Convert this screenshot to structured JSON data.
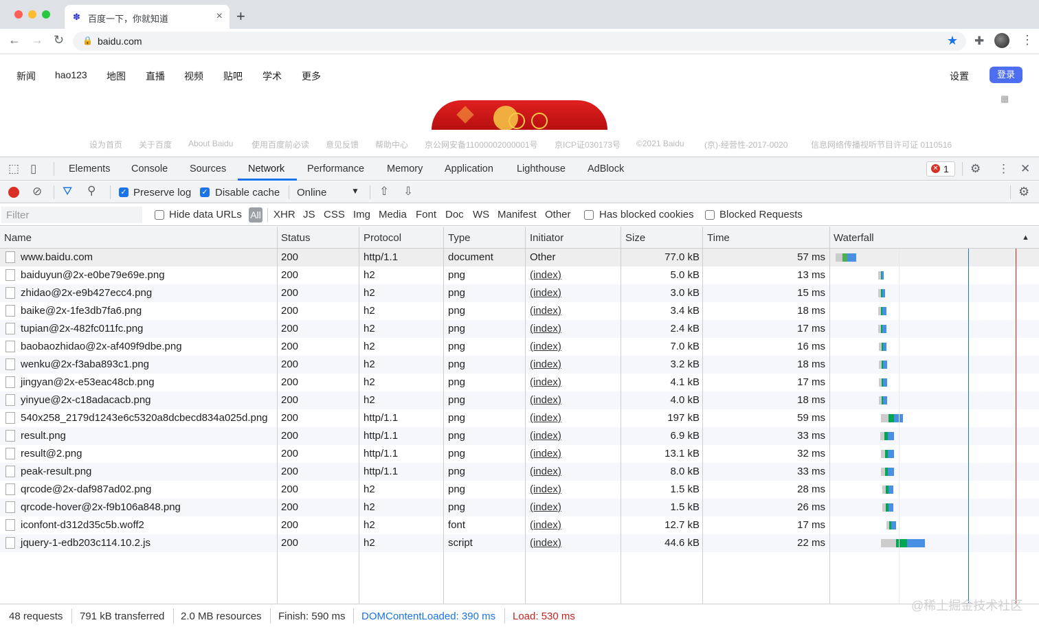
{
  "browser": {
    "tab_title": "百度一下，你就知道",
    "tab_close": "×",
    "new_tab": "+",
    "url": "baidu.com"
  },
  "page": {
    "nav_left": [
      "新闻",
      "hao123",
      "地图",
      "直播",
      "视频",
      "贴吧",
      "学术",
      "更多"
    ],
    "settings": "设置",
    "login": "登录",
    "footer_links": [
      "设为首页",
      "关于百度",
      "About Baidu",
      "使用百度前必读",
      "意见反馈",
      "帮助中心",
      "京公网安备11000002000001号",
      "京ICP证030173号",
      "©2021 Baidu",
      "(京)-经营性-2017-0020",
      "信息网络传播视听节目许可证 0110516"
    ]
  },
  "devtools": {
    "tabs": [
      "Elements",
      "Console",
      "Sources",
      "Network",
      "Performance",
      "Memory",
      "Application",
      "Lighthouse",
      "AdBlock"
    ],
    "active_tab": "Network",
    "error_count": "1",
    "controls": {
      "preserve_log": "Preserve log",
      "disable_cache": "Disable cache",
      "throttle": "Online"
    },
    "filter": {
      "placeholder": "Filter",
      "hide_data_urls": "Hide data URLs",
      "all": "All",
      "types": [
        "XHR",
        "JS",
        "CSS",
        "Img",
        "Media",
        "Font",
        "Doc",
        "WS",
        "Manifest",
        "Other"
      ],
      "has_blocked_cookies": "Has blocked cookies",
      "blocked_requests": "Blocked Requests"
    },
    "columns": [
      "Name",
      "Status",
      "Protocol",
      "Type",
      "Initiator",
      "Size",
      "Time",
      "Waterfall"
    ],
    "rows": [
      {
        "name": "www.baidu.com",
        "status": "200",
        "protocol": "http/1.1",
        "type": "document",
        "initiator": "Other",
        "size": "77.0 kB",
        "time": "57 ms"
      },
      {
        "name": "baiduyun@2x-e0be79e69e.png",
        "status": "200",
        "protocol": "h2",
        "type": "png",
        "initiator": "(index)",
        "size": "5.0 kB",
        "time": "13 ms"
      },
      {
        "name": "zhidao@2x-e9b427ecc4.png",
        "status": "200",
        "protocol": "h2",
        "type": "png",
        "initiator": "(index)",
        "size": "3.0 kB",
        "time": "15 ms"
      },
      {
        "name": "baike@2x-1fe3db7fa6.png",
        "status": "200",
        "protocol": "h2",
        "type": "png",
        "initiator": "(index)",
        "size": "3.4 kB",
        "time": "18 ms"
      },
      {
        "name": "tupian@2x-482fc011fc.png",
        "status": "200",
        "protocol": "h2",
        "type": "png",
        "initiator": "(index)",
        "size": "2.4 kB",
        "time": "17 ms"
      },
      {
        "name": "baobaozhidao@2x-af409f9dbe.png",
        "status": "200",
        "protocol": "h2",
        "type": "png",
        "initiator": "(index)",
        "size": "7.0 kB",
        "time": "16 ms"
      },
      {
        "name": "wenku@2x-f3aba893c1.png",
        "status": "200",
        "protocol": "h2",
        "type": "png",
        "initiator": "(index)",
        "size": "3.2 kB",
        "time": "18 ms"
      },
      {
        "name": "jingyan@2x-e53eac48cb.png",
        "status": "200",
        "protocol": "h2",
        "type": "png",
        "initiator": "(index)",
        "size": "4.1 kB",
        "time": "17 ms"
      },
      {
        "name": "yinyue@2x-c18adacacb.png",
        "status": "200",
        "protocol": "h2",
        "type": "png",
        "initiator": "(index)",
        "size": "4.0 kB",
        "time": "18 ms"
      },
      {
        "name": "540x258_2179d1243e6c5320a8dcbecd834a025d.png",
        "status": "200",
        "protocol": "http/1.1",
        "type": "png",
        "initiator": "(index)",
        "size": "197 kB",
        "time": "59 ms"
      },
      {
        "name": "result.png",
        "status": "200",
        "protocol": "http/1.1",
        "type": "png",
        "initiator": "(index)",
        "size": "6.9 kB",
        "time": "33 ms"
      },
      {
        "name": "result@2.png",
        "status": "200",
        "protocol": "http/1.1",
        "type": "png",
        "initiator": "(index)",
        "size": "13.1 kB",
        "time": "32 ms"
      },
      {
        "name": "peak-result.png",
        "status": "200",
        "protocol": "http/1.1",
        "type": "png",
        "initiator": "(index)",
        "size": "8.0 kB",
        "time": "33 ms"
      },
      {
        "name": "qrcode@2x-daf987ad02.png",
        "status": "200",
        "protocol": "h2",
        "type": "png",
        "initiator": "(index)",
        "size": "1.5 kB",
        "time": "28 ms"
      },
      {
        "name": "qrcode-hover@2x-f9b106a848.png",
        "status": "200",
        "protocol": "h2",
        "type": "png",
        "initiator": "(index)",
        "size": "1.5 kB",
        "time": "26 ms"
      },
      {
        "name": "iconfont-d312d35c5b.woff2",
        "status": "200",
        "protocol": "h2",
        "type": "font",
        "initiator": "(index)",
        "size": "12.7 kB",
        "time": "17 ms"
      },
      {
        "name": "jquery-1-edb203c114.10.2.js",
        "status": "200",
        "protocol": "h2",
        "type": "script",
        "initiator": "(index)",
        "size": "44.6 kB",
        "time": "22 ms"
      }
    ],
    "summary": {
      "requests": "48 requests",
      "transferred": "791 kB transferred",
      "resources": "2.0 MB resources",
      "finish": "Finish: 590 ms",
      "dcl": "DOMContentLoaded: 390 ms",
      "load": "Load: 530 ms"
    },
    "colors": {
      "accent": "#1a73e8",
      "dcl": "#1a73e8",
      "load": "#c5221f",
      "record": "#d93025"
    }
  },
  "watermark": "@稀土掘金技术社区"
}
